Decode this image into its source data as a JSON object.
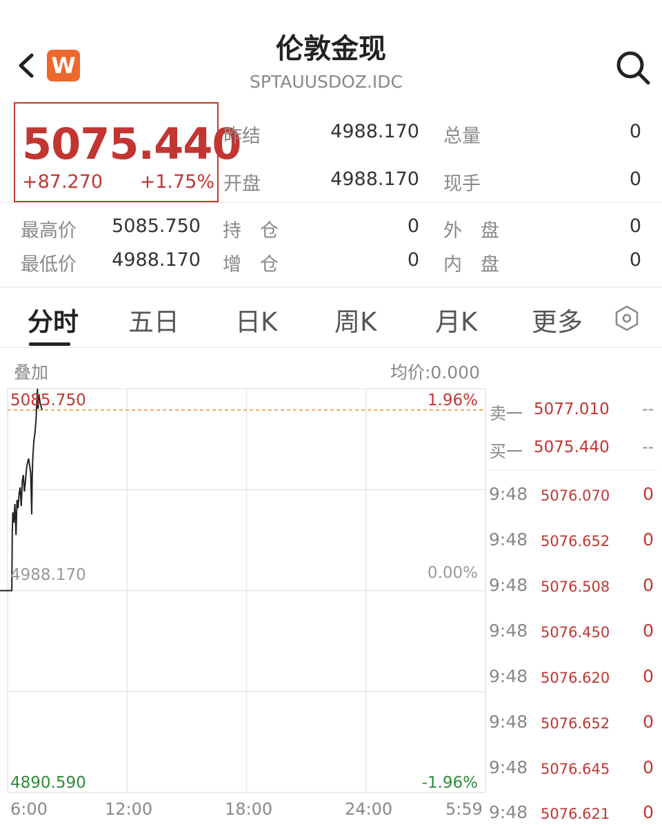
{
  "header": {
    "title": "伦敦金现",
    "subtitle": "SPTAUUSDOZ.IDC",
    "logo_letter": "W"
  },
  "quote": {
    "price": "5075.440",
    "change": "+87.270",
    "change_pct": "+1.75%"
  },
  "stats_top": [
    {
      "label": "昨结",
      "value": "4988.170"
    },
    {
      "label": "开盘",
      "value": "4988.170"
    },
    {
      "label": "总量",
      "value": "0"
    },
    {
      "label": "现手",
      "value": "0"
    }
  ],
  "stats_bottom": [
    {
      "label": "最高价",
      "value": "5085.750"
    },
    {
      "label": "最低价",
      "value": "4988.170"
    },
    {
      "label": "持　仓",
      "value": "0"
    },
    {
      "label": "增　仓",
      "value": "0"
    },
    {
      "label": "外　盘",
      "value": "0"
    },
    {
      "label": "内　盘",
      "value": "0"
    }
  ],
  "tabs": [
    "分时",
    "五日",
    "日K",
    "周K",
    "月K",
    "更多"
  ],
  "chart_header": {
    "left": "叠加",
    "right": "均价:0.000"
  },
  "chart_data": {
    "type": "line",
    "y_labels_left": {
      "top": "5085.750",
      "mid": "4988.170",
      "bottom": "4890.590"
    },
    "y_labels_right": {
      "top": "1.96%",
      "mid": "0.00%",
      "bottom": "-1.96%"
    },
    "x_labels": [
      "6:00",
      "12:00",
      "18:00",
      "24:00",
      "5:59"
    ],
    "ylim": [
      4890.59,
      5085.75
    ],
    "base": 4988.17,
    "reference_line": 5075.44,
    "series": [
      {
        "x": [
          0,
          4,
          8,
          9,
          10,
          12,
          14,
          16,
          18,
          20,
          22,
          24,
          26,
          28,
          30,
          32,
          34,
          36,
          38,
          40,
          42,
          44,
          46,
          47,
          48,
          50,
          52,
          54,
          56,
          57,
          58,
          60,
          62,
          64,
          66
        ],
        "y": [
          4988.17,
          4988.17,
          4988.17,
          5016,
          5026,
          5021,
          5030,
          5015,
          5032,
          5028,
          5035,
          5038,
          5029,
          5041,
          5044,
          5036,
          5041,
          5047,
          5050,
          5052,
          5049,
          5045,
          5025,
          5043,
          5052,
          5060,
          5064,
          5070,
          5080,
          5085.75,
          5076,
          5083,
          5079,
          5077,
          5075.44
        ]
      }
    ]
  },
  "book": {
    "ask": {
      "label": "卖一",
      "price": "5077.010",
      "vol": "--"
    },
    "bid": {
      "label": "买一",
      "price": "5075.440",
      "vol": "--"
    }
  },
  "ticks": [
    {
      "time": "9:48",
      "price": "5076.070",
      "vol": "0"
    },
    {
      "time": "9:48",
      "price": "5076.652",
      "vol": "0"
    },
    {
      "time": "9:48",
      "price": "5076.508",
      "vol": "0"
    },
    {
      "time": "9:48",
      "price": "5076.450",
      "vol": "0"
    },
    {
      "time": "9:48",
      "price": "5076.620",
      "vol": "0"
    },
    {
      "time": "9:48",
      "price": "5076.652",
      "vol": "0"
    },
    {
      "time": "9:48",
      "price": "5076.645",
      "vol": "0"
    },
    {
      "time": "9:48",
      "price": "5076.621",
      "vol": "0"
    }
  ],
  "colors": {
    "up": "#c23531",
    "down": "#2e8b3a",
    "logo": "#f0672b",
    "ref_line": "#e8902a"
  }
}
